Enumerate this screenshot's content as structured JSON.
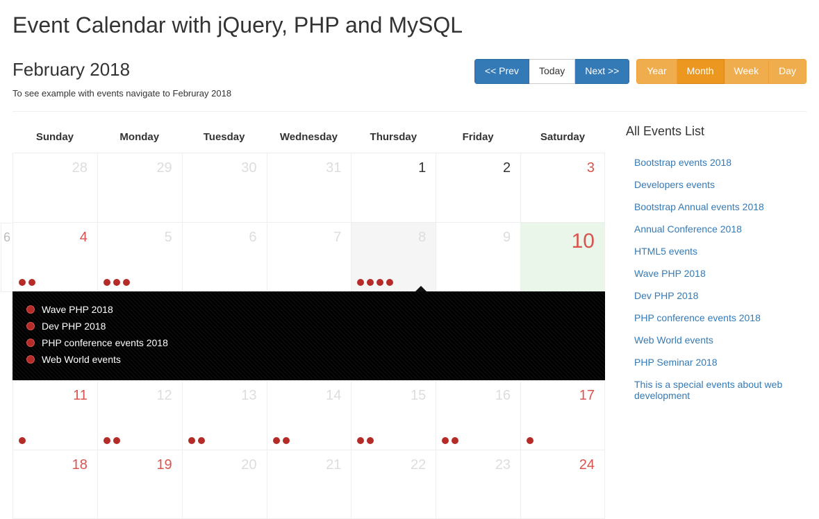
{
  "page_title": "Event Calendar with jQuery, PHP and MySQL",
  "current_month": "February 2018",
  "helper_text": "To see example with events navigate to Februray 2018",
  "nav": {
    "prev": "<< Prev",
    "today": "Today",
    "next": "Next >>"
  },
  "views": {
    "year": "Year",
    "month": "Month",
    "week": "Week",
    "day": "Day",
    "active": "Month"
  },
  "dow": [
    "Sunday",
    "Monday",
    "Tuesday",
    "Wednesday",
    "Thursday",
    "Friday",
    "Saturday"
  ],
  "stub_day": "6",
  "weeks": [
    [
      {
        "n": "28",
        "cls": "other-month"
      },
      {
        "n": "29",
        "cls": "other-month"
      },
      {
        "n": "30",
        "cls": "other-month"
      },
      {
        "n": "31",
        "cls": "other-month"
      },
      {
        "n": "1",
        "cls": ""
      },
      {
        "n": "2",
        "cls": ""
      },
      {
        "n": "3",
        "cls": "weekend"
      }
    ],
    [
      {
        "n": "4",
        "cls": "weekend",
        "dots": 2
      },
      {
        "n": "5",
        "cls": "faded",
        "dots": 3
      },
      {
        "n": "6",
        "cls": "faded"
      },
      {
        "n": "7",
        "cls": "faded"
      },
      {
        "n": "8",
        "cls": "sel faded",
        "dots": 4
      },
      {
        "n": "9",
        "cls": "faded"
      },
      {
        "n": "10",
        "cls": "today weekend"
      }
    ],
    [
      {
        "n": "11",
        "cls": "weekend",
        "dots": 1
      },
      {
        "n": "12",
        "cls": "faded",
        "dots": 2
      },
      {
        "n": "13",
        "cls": "faded",
        "dots": 2
      },
      {
        "n": "14",
        "cls": "faded",
        "dots": 2
      },
      {
        "n": "15",
        "cls": "faded",
        "dots": 2
      },
      {
        "n": "16",
        "cls": "faded",
        "dots": 2
      },
      {
        "n": "17",
        "cls": "weekend",
        "dots": 1
      }
    ],
    [
      {
        "n": "18",
        "cls": "weekend"
      },
      {
        "n": "19",
        "cls": "weekend"
      },
      {
        "n": "20",
        "cls": "faded"
      },
      {
        "n": "21",
        "cls": "faded"
      },
      {
        "n": "22",
        "cls": "faded"
      },
      {
        "n": "23",
        "cls": "faded"
      },
      {
        "n": "24",
        "cls": "weekend"
      }
    ]
  ],
  "expanded_after_week": 1,
  "expanded_events": [
    "Wave PHP 2018",
    "Dev PHP 2018",
    "PHP conference events 2018",
    "Web World events"
  ],
  "sidebar": {
    "title": "All Events List",
    "items": [
      "Bootstrap events 2018",
      "Developers events",
      "Bootstrap Annual events 2018",
      "Annual Conference 2018",
      "HTML5 events",
      "Wave PHP 2018",
      "Dev PHP 2018",
      "PHP conference events 2018",
      "Web World events",
      "PHP Seminar 2018",
      "This is a special events about web development"
    ]
  }
}
